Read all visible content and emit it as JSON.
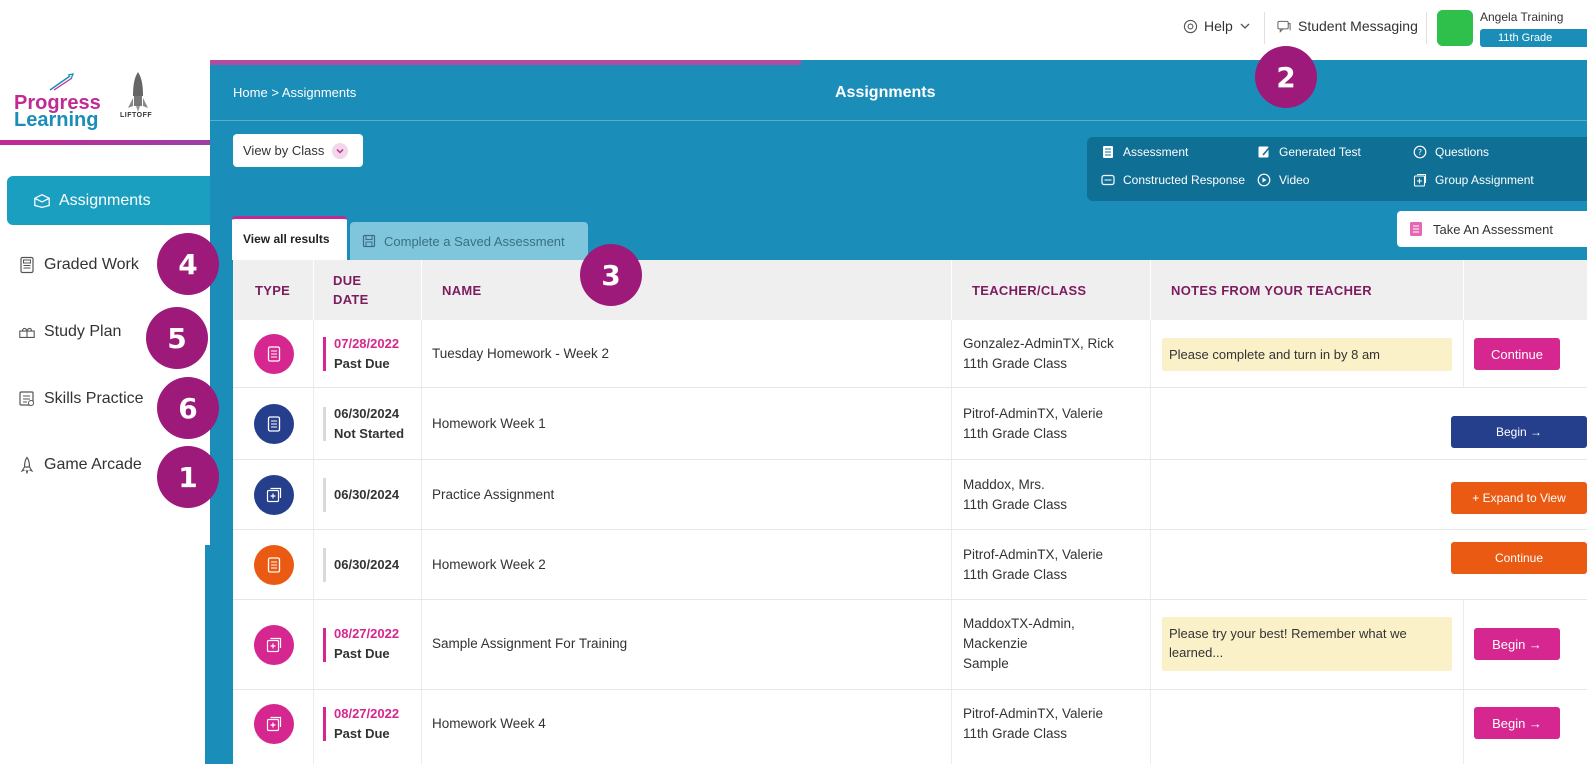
{
  "topbar": {
    "help_label": "Help",
    "messaging_label": "Student Messaging",
    "user_name": "Angela Training",
    "user_grade": "11th Grade"
  },
  "logo": {
    "line1": "Progress",
    "line2": "Learning",
    "partner": "LIFTOFF"
  },
  "sidebar": {
    "items": [
      {
        "label": "Assignments",
        "icon": "assignments-icon",
        "active": true
      },
      {
        "label": "Graded Work",
        "icon": "graded-work-icon",
        "badge": "4"
      },
      {
        "label": "Study Plan",
        "icon": "study-plan-icon",
        "badge": "5"
      },
      {
        "label": "Skills Practice",
        "icon": "skills-practice-icon",
        "badge": "6"
      },
      {
        "label": "Game Arcade",
        "icon": "rocket-icon",
        "badge": "1"
      }
    ]
  },
  "badges": {
    "messaging": "2",
    "saved_tab": "3"
  },
  "header": {
    "breadcrumb_home": "Home",
    "breadcrumb_sep": ">",
    "breadcrumb_current": "Assignments",
    "title": "Assignments"
  },
  "filters": {
    "view_by_label": "View by Class"
  },
  "legend": {
    "assessment": "Assessment",
    "generated_test": "Generated Test",
    "questions": "Questions",
    "constructed_response": "Constructed Response",
    "video": "Video",
    "group_assignment": "Group Assignment"
  },
  "take_assessment_label": "Take An Assessment",
  "tabs": {
    "all_results": "View all results",
    "saved": "Complete a Saved Assessment"
  },
  "table": {
    "headers": {
      "type": "TYPE",
      "due_line1": "DUE",
      "due_line2": "DATE",
      "name": "NAME",
      "teacher": "TEACHER/CLASS",
      "notes": "NOTES FROM YOUR TEACHER"
    },
    "rows": [
      {
        "type": "assessment",
        "type_color": "#d6268f",
        "due": "07/28/2022",
        "status": "Past Due",
        "name": "Tuesday Homework - Week 2",
        "teacher": [
          "Gonzalez-AdminTX, Rick",
          "11th Grade Class"
        ],
        "note": "Please complete and turn in by 8 am",
        "action": "Continue",
        "action_color": "#d6268f"
      },
      {
        "type": "assessment",
        "type_color": "#253f8c",
        "due": "06/30/2024",
        "status": "Not Started",
        "name": "Homework Week 1",
        "teacher": [
          "Pitrof-AdminTX, Valerie",
          "11th Grade Class"
        ],
        "note": "",
        "action": "Begin →",
        "action_color": "#253f8c"
      },
      {
        "type": "group-assignment",
        "type_color": "#253f8c",
        "due": "06/30/2024",
        "status": "",
        "name": "Practice Assignment",
        "teacher": [
          "Maddox, Mrs.",
          "11th Grade Class"
        ],
        "note": "",
        "action": "+ Expand to View",
        "action_color": "#ea5a12"
      },
      {
        "type": "assessment",
        "type_color": "#ea5a12",
        "due": "06/30/2024",
        "status": "",
        "name": "Homework Week 2",
        "teacher": [
          "Pitrof-AdminTX, Valerie",
          "11th Grade Class"
        ],
        "note": "",
        "action": "Continue",
        "action_color": "#ea5a12"
      },
      {
        "type": "group-assignment",
        "type_color": "#d6268f",
        "due": "08/27/2022",
        "status": "Past Due",
        "name": "Sample Assignment For Training",
        "teacher": [
          "MaddoxTX-Admin,",
          "Mackenzie",
          "Sample"
        ],
        "note": "Please try your best! Remember what we learned...",
        "action": "Begin →",
        "action_color": "#d6268f"
      },
      {
        "type": "group-assignment",
        "type_color": "#d6268f",
        "due": "08/27/2022",
        "status": "Past Due",
        "name": "Homework Week 4",
        "teacher": [
          "Pitrof-AdminTX, Valerie",
          "11th Grade Class"
        ],
        "note": "",
        "action": "Begin →",
        "action_color": "#d6268f"
      }
    ]
  }
}
